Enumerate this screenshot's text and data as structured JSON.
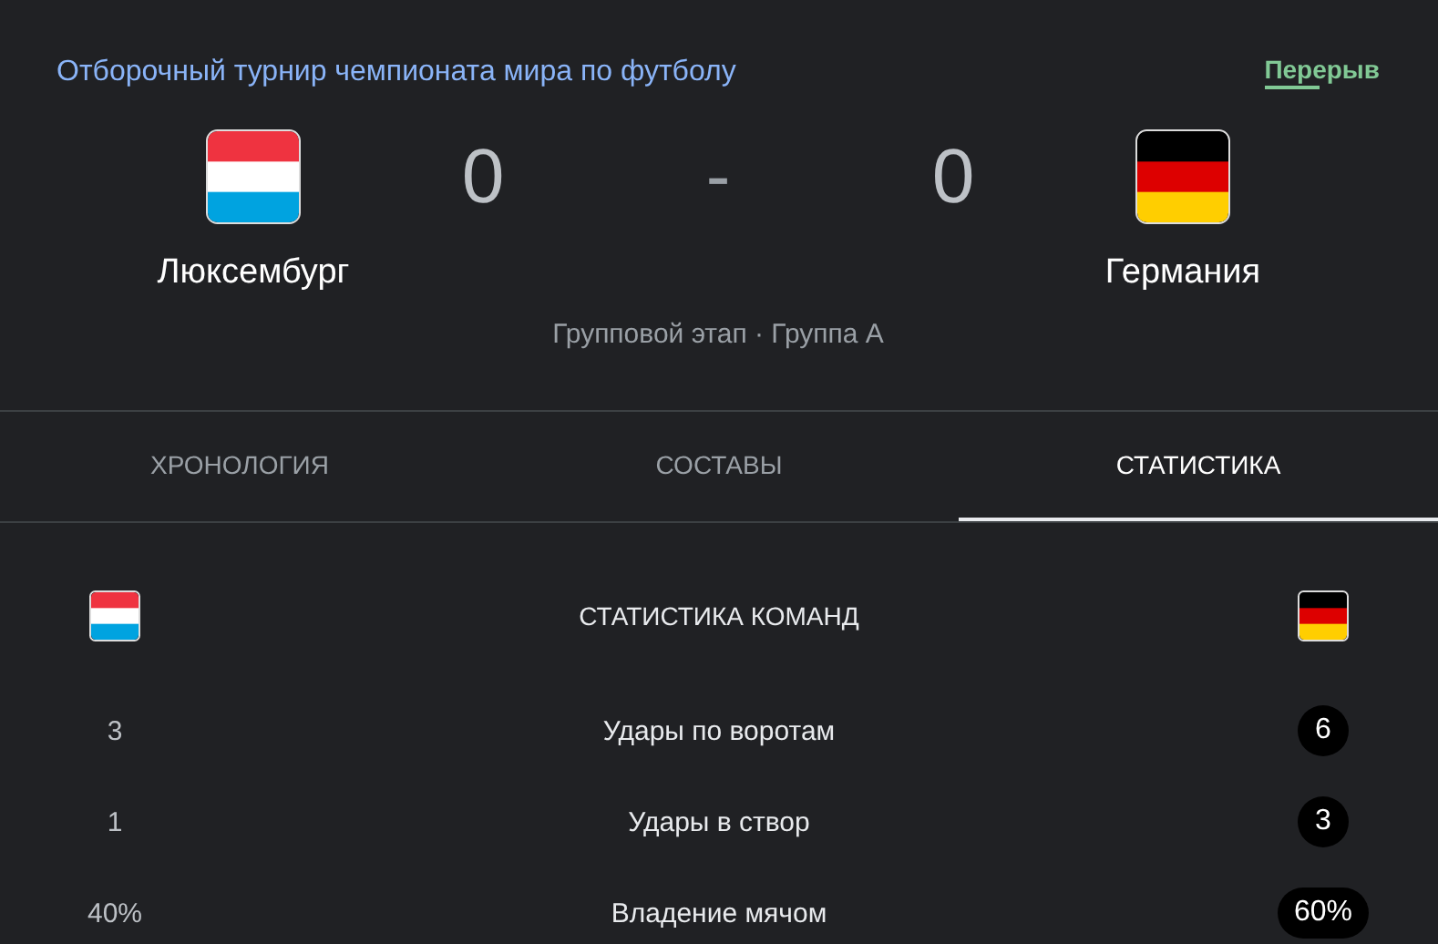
{
  "competition": "Отборочный турнир чемпионата мира по футболу",
  "status": "Перерыв",
  "teams": [
    {
      "name": "Люксембург",
      "score": "0",
      "kind": "luxembourg"
    },
    {
      "name": "Германия",
      "score": "0",
      "kind": "germany"
    }
  ],
  "score_separator": "-",
  "stage": "Групповой этап · Группа A",
  "tabs": [
    {
      "label": "ХРОНОЛОГИЯ",
      "selected": false
    },
    {
      "label": "СОСТАВЫ",
      "selected": false
    },
    {
      "label": "СТАТИСТИКА",
      "selected": true
    }
  ],
  "stats": {
    "title": "СТАТИСТИКА КОМАНД",
    "rows": [
      {
        "label": "Удары по воротам",
        "home": "3",
        "away": "6",
        "home_leading": false,
        "away_leading": true
      },
      {
        "label": "Удары в створ",
        "home": "1",
        "away": "3",
        "home_leading": false,
        "away_leading": true
      },
      {
        "label": "Владение мячом",
        "home": "40%",
        "away": "60%",
        "home_leading": false,
        "away_leading": true
      }
    ]
  }
}
